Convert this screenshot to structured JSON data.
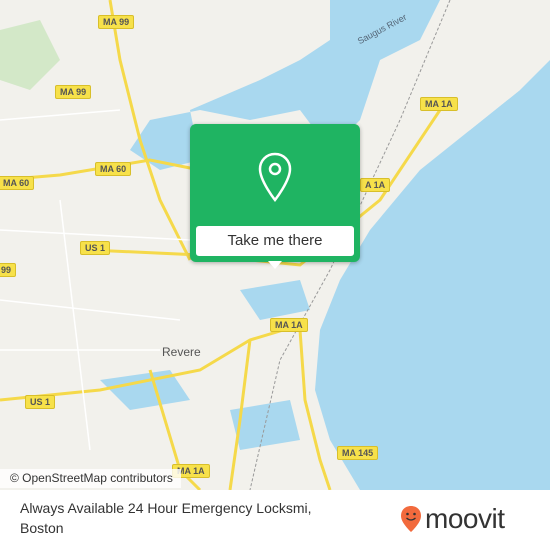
{
  "map": {
    "place_labels": [
      "Revere"
    ],
    "river_label": "Saugus River",
    "road_shields": [
      "MA 99",
      "MA 99",
      "MA 60",
      "MA 60",
      "US 1",
      "99",
      "MA 1A",
      "A 1A",
      "MA 1A",
      "US 1",
      "MA 145",
      "MA 1A"
    ],
    "colors": {
      "water": "#a9d8ef",
      "land": "#f2f1ec",
      "road_major": "#f5d94a",
      "accent": "#1fb462",
      "brand": "#f26a3d"
    }
  },
  "popup": {
    "button_label": "Take me there",
    "icon": "map-pin-icon"
  },
  "attribution": "© OpenStreetMap contributors",
  "footer": {
    "title_line1": "Always Available 24 Hour Emergency Locksmi,",
    "title_line2": "Boston",
    "logo_text": "moovit"
  }
}
